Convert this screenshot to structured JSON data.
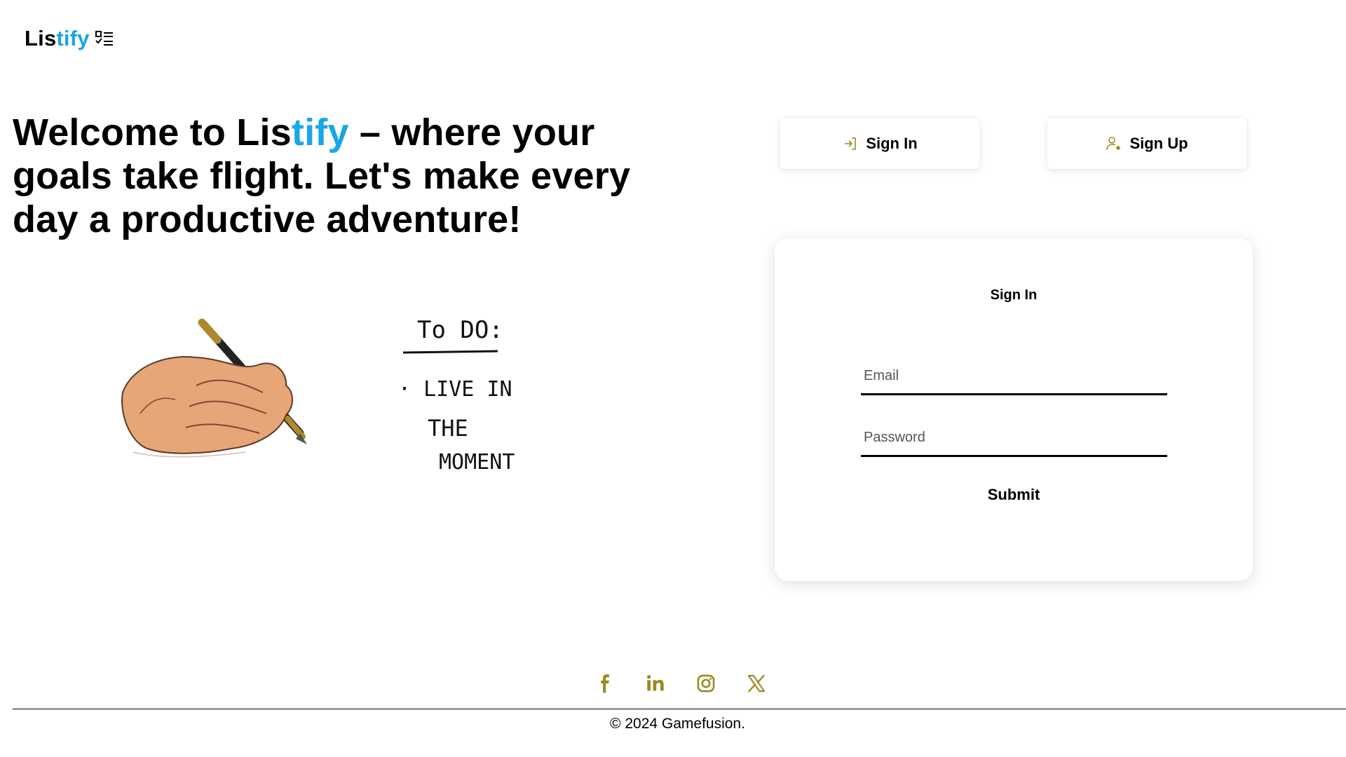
{
  "colors": {
    "accent": "#1aa6e6",
    "icon_gold": "#9a8a1e",
    "text": "#000000"
  },
  "logo": {
    "part1": "Lis",
    "part2": "tify",
    "icon": "checklist-icon"
  },
  "hero": {
    "title_part1": "Welcome to Lis",
    "title_accent": "tify",
    "title_part2": " – where your goals take flight. Let's make every day a productive adventure!"
  },
  "illustration": {
    "todo_heading": "To DO:",
    "todo_line1": "· LIVE IN",
    "todo_line2": "THE",
    "todo_line3": "MOMENT"
  },
  "tabs": {
    "signin_label": "Sign In",
    "signin_icon": "login-icon",
    "signup_label": "Sign Up",
    "signup_icon": "user-add-icon"
  },
  "form": {
    "title": "Sign In",
    "email_placeholder": "Email",
    "email_value": "",
    "password_placeholder": "Password",
    "password_value": "",
    "submit_label": "Submit"
  },
  "social": [
    {
      "name": "facebook-icon"
    },
    {
      "name": "linkedin-icon"
    },
    {
      "name": "instagram-icon"
    },
    {
      "name": "x-icon"
    }
  ],
  "footer": {
    "copyright": "© 2024 Gamefusion."
  }
}
